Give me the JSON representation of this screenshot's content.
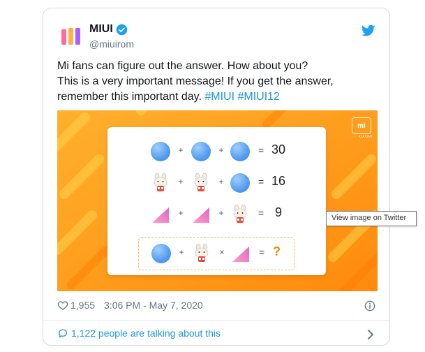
{
  "tweet": {
    "display_name": "MIUI",
    "handle": "@miuirom",
    "text_line1": "Mi fans can figure out the answer. How about you?",
    "text_line2": "This is a very important message! If you get the answer,",
    "text_line3_prefix": "remember this important day. ",
    "hashtag1": "#MIUI",
    "hashtag2": "#MIUI12",
    "likes": "1,955",
    "timestamp": "3:06 PM - May 7, 2020",
    "conversation": "1,122 people are talking about this"
  },
  "media": {
    "badge": "mi",
    "badge_sub": "XIAOMI",
    "equations": [
      {
        "items": [
          "ball",
          "ball",
          "ball"
        ],
        "ops": [
          "+",
          "+"
        ],
        "result": "30"
      },
      {
        "items": [
          "bunny",
          "bunny",
          "ball"
        ],
        "ops": [
          "+",
          "+"
        ],
        "result": "16"
      },
      {
        "items": [
          "triangle",
          "triangle",
          "bunny"
        ],
        "ops": [
          "+",
          "+"
        ],
        "result": "9"
      },
      {
        "items": [
          "ball",
          "bunny",
          "triangle"
        ],
        "ops": [
          "+",
          "×"
        ],
        "result": "?"
      }
    ],
    "equals": "="
  },
  "tooltip": "View image on Twitter",
  "colors": {
    "accent": "#1b95e0",
    "media_bg": "#ff9a1a",
    "question": "#f08a00"
  }
}
